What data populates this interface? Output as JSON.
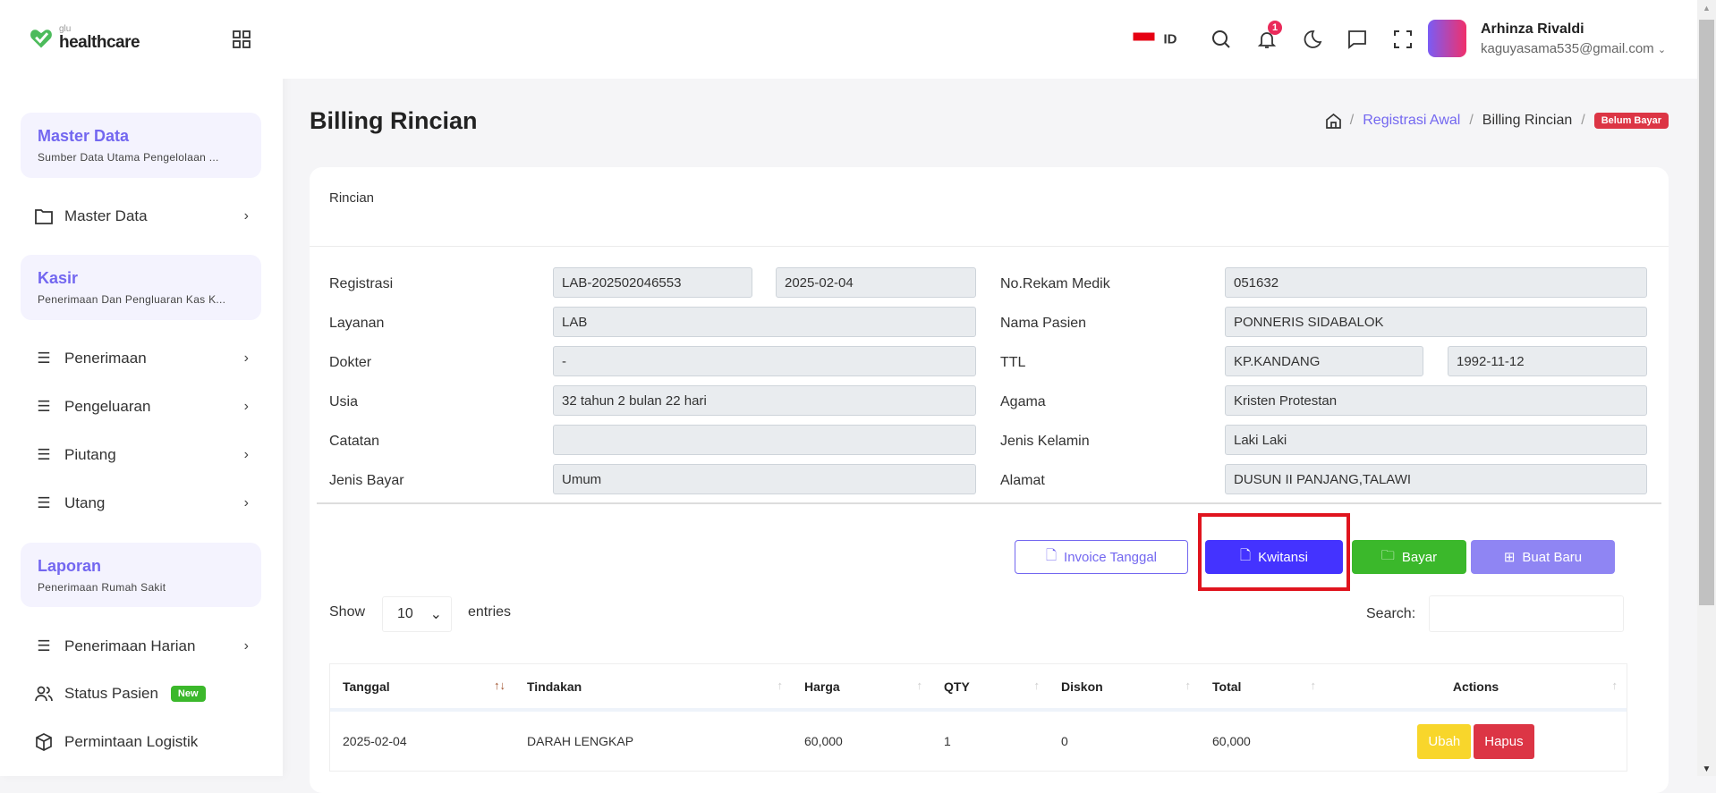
{
  "brand": {
    "small": "glu",
    "name": "healthcare"
  },
  "sidebar": {
    "sections": [
      {
        "title": "Master Data",
        "subtitle": "Sumber Data Utama Pengelolaan ..."
      },
      {
        "title": "Kasir",
        "subtitle": "Penerimaan Dan Pengluaran Kas K..."
      },
      {
        "title": "Laporan",
        "subtitle": "Penerimaan Rumah Sakit"
      }
    ],
    "items": [
      {
        "label": "Master Data",
        "icon": "folder-icon"
      },
      {
        "label": "Penerimaan",
        "icon": "list-icon"
      },
      {
        "label": "Pengeluaran",
        "icon": "list-icon"
      },
      {
        "label": "Piutang",
        "icon": "list-icon"
      },
      {
        "label": "Utang",
        "icon": "list-icon"
      },
      {
        "label": "Penerimaan Harian",
        "icon": "list-icon"
      },
      {
        "label": "Status Pasien",
        "icon": "users-icon",
        "badge": "New"
      },
      {
        "label": "Permintaan Logistik",
        "icon": "box-icon"
      }
    ]
  },
  "header": {
    "lang": "ID",
    "notifications": "1",
    "user_name": "Arhinza Rivaldi",
    "user_email": "kaguyasama535@gmail.com"
  },
  "page": {
    "title": "Billing Rincian",
    "breadcrumb": [
      "Registrasi Awal",
      "Billing Rincian"
    ],
    "status": "Belum Bayar",
    "card_title": "Rincian"
  },
  "form": {
    "registrasi_label": "Registrasi",
    "registrasi": "LAB-202502046553",
    "tanggal": "2025-02-04",
    "layanan_label": "Layanan",
    "layanan": "LAB",
    "dokter_label": "Dokter",
    "dokter": "-",
    "usia_label": "Usia",
    "usia": "32 tahun 2 bulan 22 hari",
    "catatan_label": "Catatan",
    "catatan": "",
    "jenis_bayar_label": "Jenis Bayar",
    "jenis_bayar": "Umum",
    "rm_label": "No.Rekam Medik",
    "rm": "051632",
    "nama_label": "Nama Pasien",
    "nama": "PONNERIS SIDABALOK",
    "ttl_label": "TTL",
    "tempat_lahir": "KP.KANDANG",
    "tgl_lahir": "1992-11-12",
    "agama_label": "Agama",
    "agama": "Kristen Protestan",
    "jk_label": "Jenis Kelamin",
    "jk": "Laki Laki",
    "alamat_label": "Alamat",
    "alamat": "DUSUN II PANJANG,TALAWI"
  },
  "actions": {
    "invoice": "Invoice Tanggal",
    "kwitansi": "Kwitansi",
    "bayar": "Bayar",
    "buat_baru": "Buat Baru"
  },
  "table": {
    "show": "Show",
    "entries_value": "10",
    "entries": "entries",
    "search_label": "Search:",
    "columns": [
      "Tanggal",
      "Tindakan",
      "Harga",
      "QTY",
      "Diskon",
      "Total",
      "Actions"
    ],
    "rows": [
      {
        "tanggal": "2025-02-04",
        "tindakan": "DARAH LENGKAP",
        "harga": "60,000",
        "qty": "1",
        "diskon": "0",
        "total": "60,000",
        "edit": "Ubah",
        "delete": "Hapus"
      }
    ]
  },
  "colors": {
    "primary": "#7367f0",
    "kwitansi": "#4433ff",
    "bayar": "#3bb82b",
    "danger": "#dc3545",
    "warning": "#f8d62b",
    "highlight": "#e0141e"
  }
}
